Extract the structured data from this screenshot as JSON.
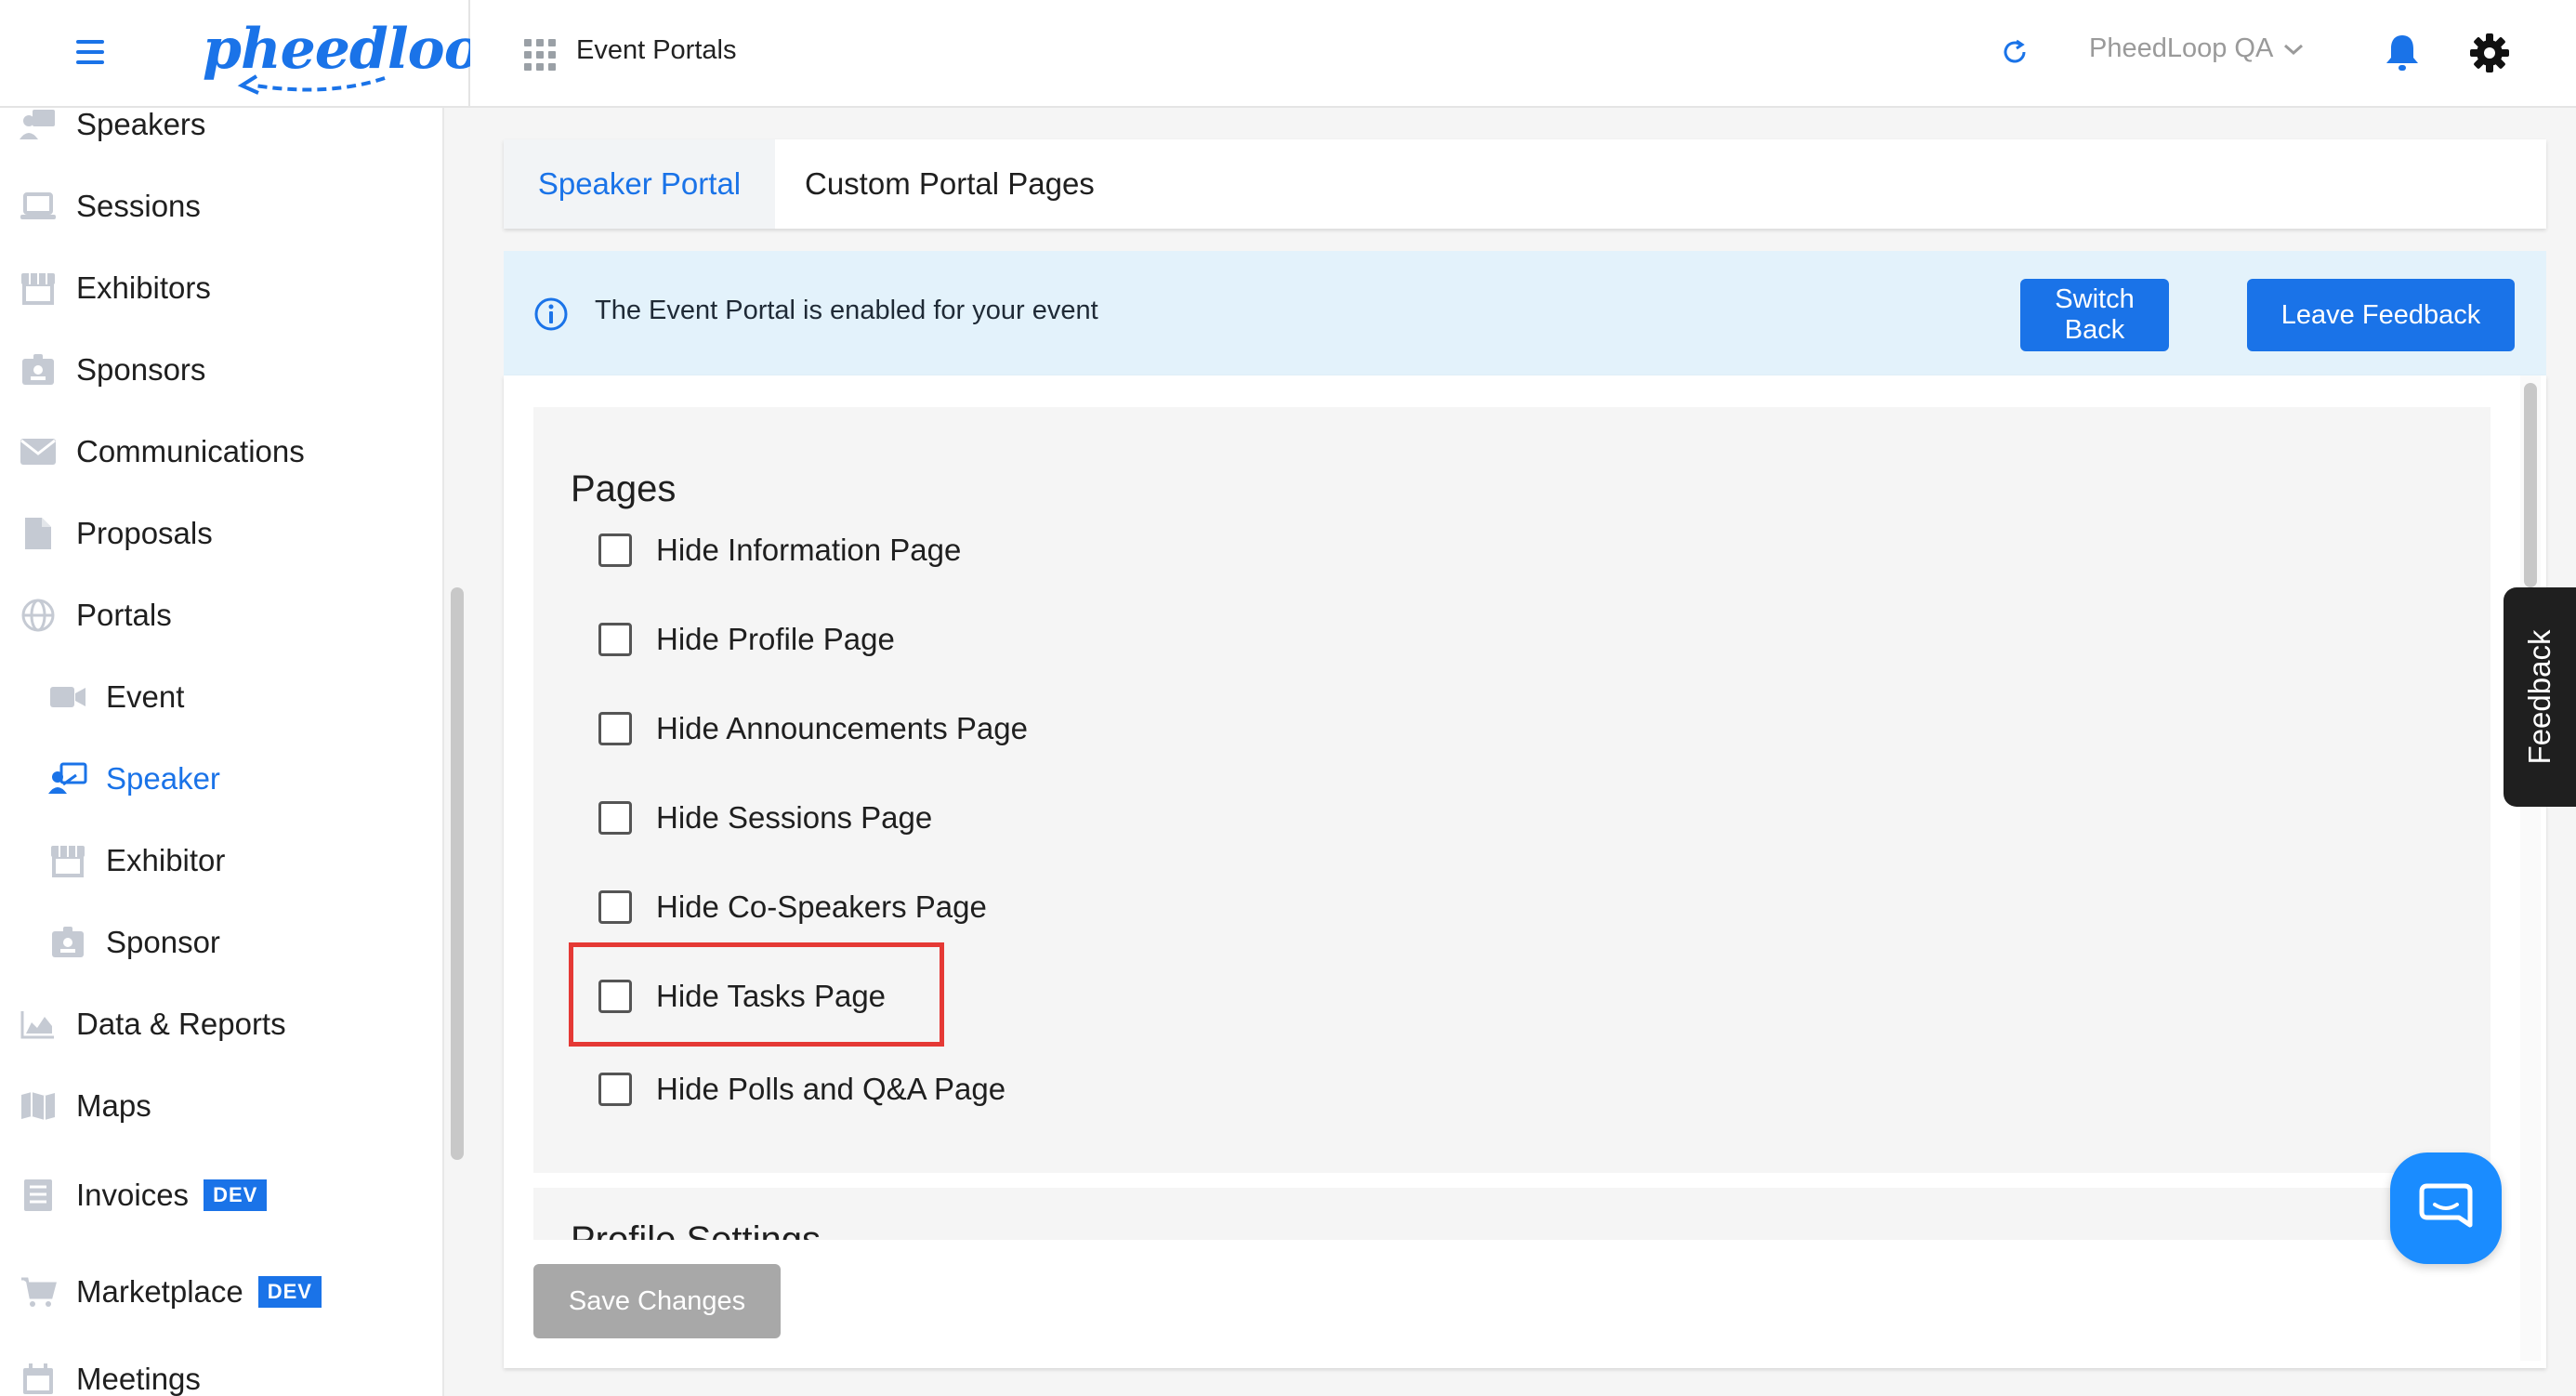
{
  "header": {
    "logo_text": "pheedloop",
    "title": "Event Portals",
    "org_name": "PheedLoop QA"
  },
  "sidebar": {
    "items": [
      {
        "label": "Speakers",
        "icon": "speakers-icon"
      },
      {
        "label": "Sessions",
        "icon": "laptop-icon"
      },
      {
        "label": "Exhibitors",
        "icon": "storefront-icon"
      },
      {
        "label": "Sponsors",
        "icon": "badge-icon"
      },
      {
        "label": "Communications",
        "icon": "envelope-icon"
      },
      {
        "label": "Proposals",
        "icon": "document-icon"
      },
      {
        "label": "Portals",
        "icon": "globe-icon"
      },
      {
        "label": "Event",
        "icon": "video-icon"
      },
      {
        "label": "Speaker",
        "icon": "presenter-icon"
      },
      {
        "label": "Exhibitor",
        "icon": "storefront-icon"
      },
      {
        "label": "Sponsor",
        "icon": "badge-icon"
      },
      {
        "label": "Data & Reports",
        "icon": "chart-icon"
      },
      {
        "label": "Maps",
        "icon": "map-icon"
      },
      {
        "label": "Invoices",
        "icon": "invoice-icon",
        "badge": "DEV"
      },
      {
        "label": "Marketplace",
        "icon": "cart-icon",
        "badge": "DEV"
      },
      {
        "label": "Meetings",
        "icon": "calendar-icon"
      }
    ],
    "active": "Speaker"
  },
  "tabs": [
    {
      "label": "Speaker Portal",
      "active": true
    },
    {
      "label": "Custom Portal Pages",
      "active": false
    }
  ],
  "banner": {
    "text": "The Event Portal is enabled for your event",
    "switch_back": "Switch Back",
    "leave_feedback": "Leave Feedback"
  },
  "pages": {
    "title": "Pages",
    "options": [
      {
        "label": "Hide Information Page",
        "checked": false
      },
      {
        "label": "Hide Profile Page",
        "checked": false
      },
      {
        "label": "Hide Announcements Page",
        "checked": false
      },
      {
        "label": "Hide Sessions Page",
        "checked": false
      },
      {
        "label": "Hide Co-Speakers Page",
        "checked": false
      },
      {
        "label": "Hide Tasks Page",
        "checked": false
      },
      {
        "label": "Hide Polls and Q&A Page",
        "checked": false
      }
    ]
  },
  "profile_settings": {
    "title": "Profile Settings"
  },
  "save_label": "Save Changes",
  "feedback_tab": "Feedback",
  "colors": {
    "accent": "#1a73e8",
    "highlight": "#e53935"
  }
}
